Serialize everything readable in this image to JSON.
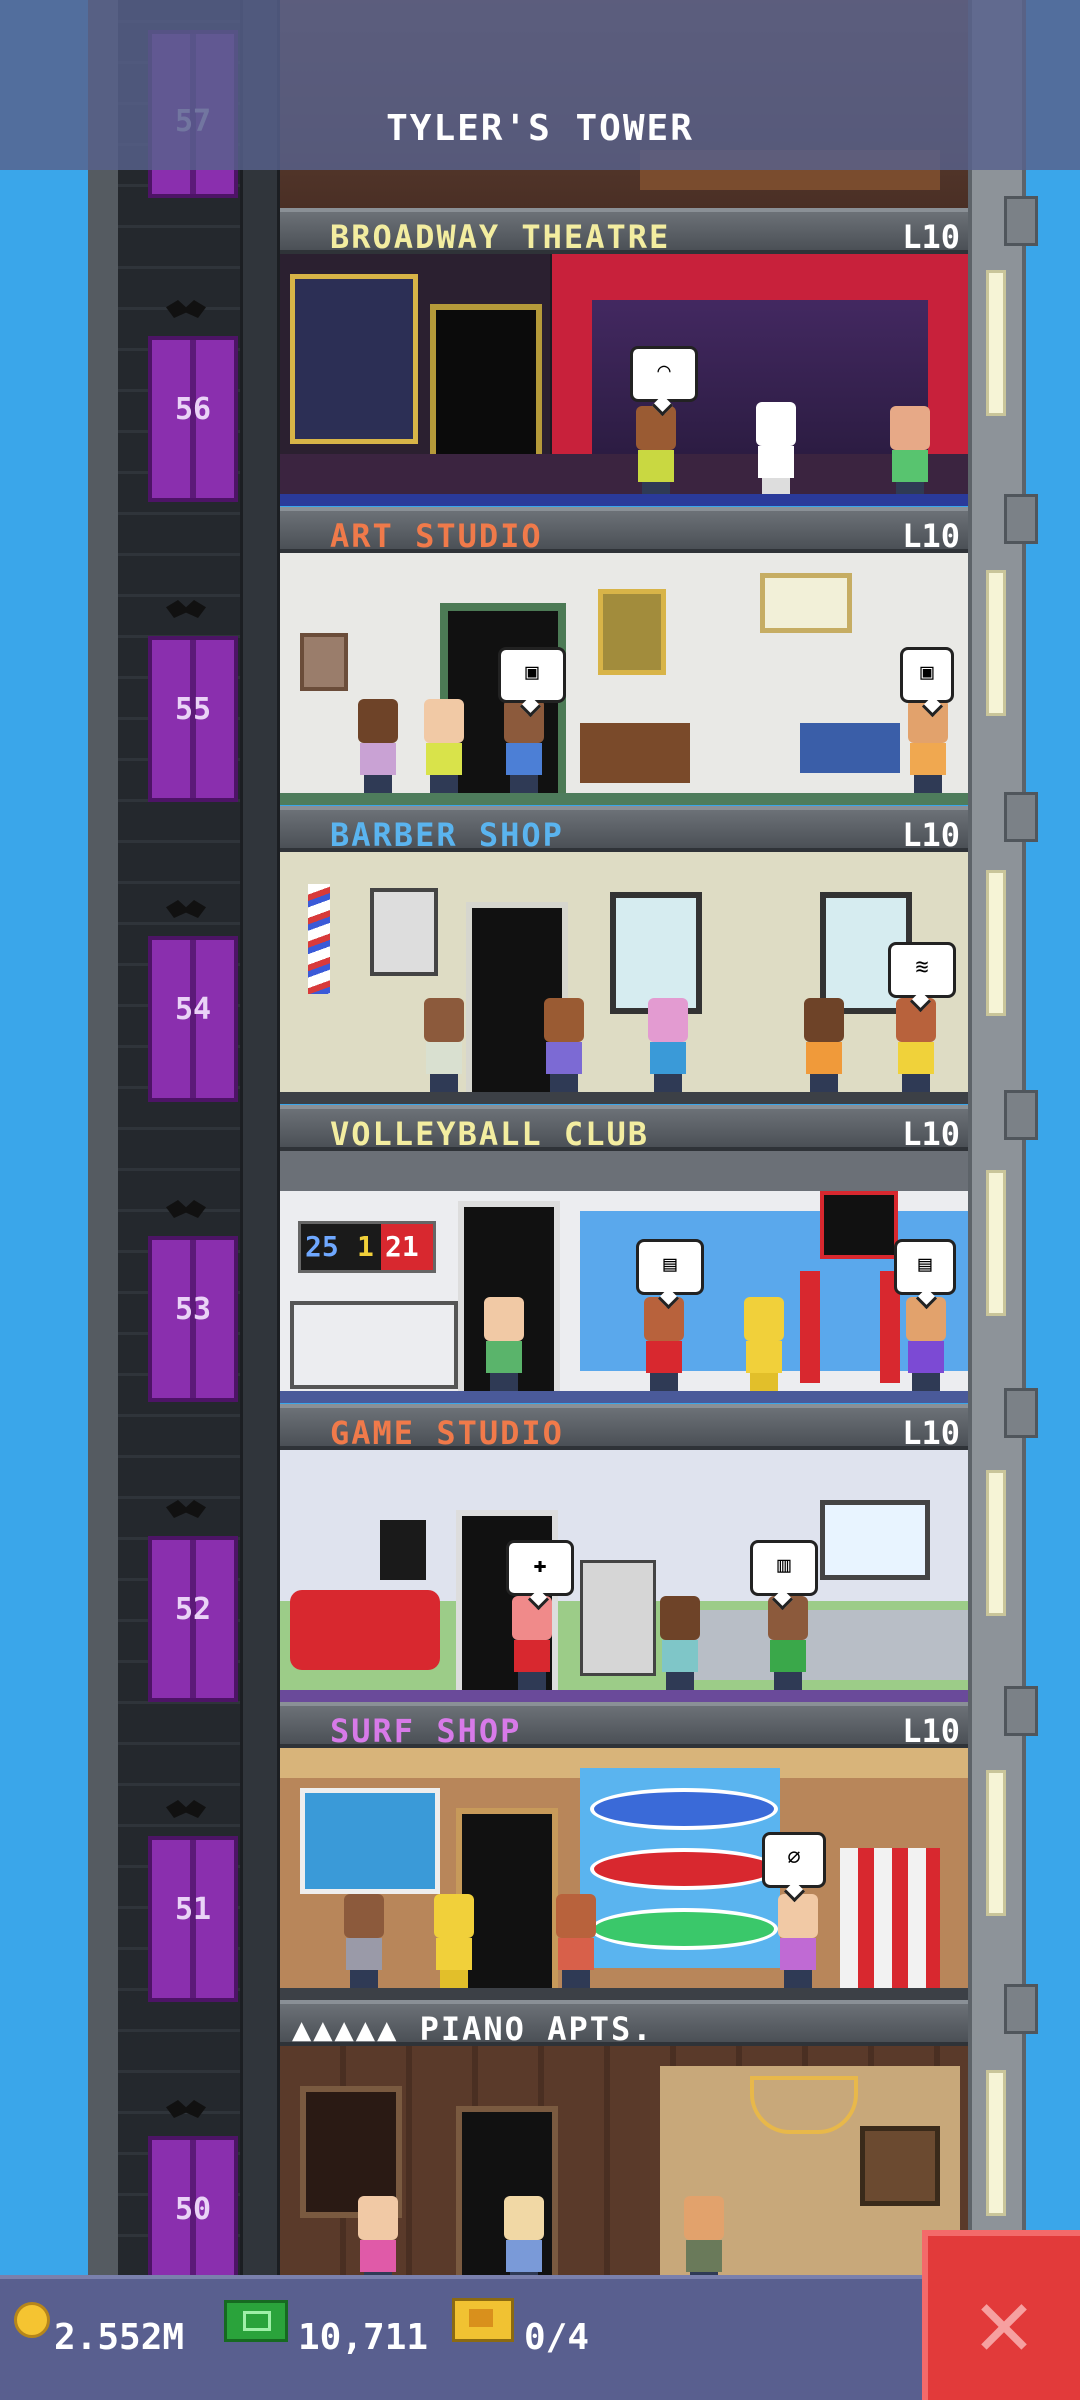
{
  "header": {
    "title": "TYLER'S TOWER"
  },
  "top_floor_number": "57",
  "floors": [
    {
      "number": "56",
      "name": "BROADWAY THEATRE",
      "level": "L10",
      "name_color": "#f3eda0"
    },
    {
      "number": "55",
      "name": "ART STUDIO",
      "level": "L10",
      "name_color": "#f07a4a"
    },
    {
      "number": "54",
      "name": "BARBER SHOP",
      "level": "L10",
      "name_color": "#5ab4ef"
    },
    {
      "number": "53",
      "name": "VOLLEYBALL CLUB",
      "level": "L10",
      "name_color": "#f3eda0"
    },
    {
      "number": "52",
      "name": "GAME STUDIO",
      "level": "L10",
      "name_color": "#f07a4a"
    },
    {
      "number": "51",
      "name": "SURF SHOP",
      "level": "L10",
      "name_color": "#d77ae8"
    },
    {
      "number": "50",
      "name": "▲▲▲▲▲ PIANO APTS.",
      "level": "",
      "name_color": "#ffffff"
    }
  ],
  "scoreboard": {
    "left": "25",
    "mid": "1",
    "right": "21"
  },
  "bottom_bar": {
    "coins": "2.552M",
    "bux": "10,711",
    "tickets": "0/4"
  },
  "icons": {
    "coin": "coin-icon",
    "bux": "tower-bux-icon",
    "ticket": "vip-ticket-icon",
    "close": "close-icon"
  },
  "colors": {
    "sky": "#3aa6ea",
    "elevator": "#8a2fae",
    "close_button": "#e23a3a"
  }
}
